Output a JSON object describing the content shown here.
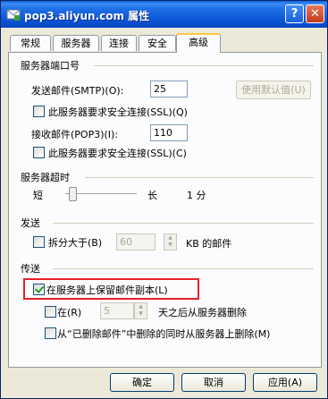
{
  "window": {
    "title": "pop3.aliyun.com 属性",
    "help_label": "?",
    "close_label": "✕"
  },
  "tabs": [
    {
      "label": "常规"
    },
    {
      "label": "服务器"
    },
    {
      "label": "连接"
    },
    {
      "label": "安全"
    },
    {
      "label": "高级"
    }
  ],
  "active_tab": "高级",
  "ports": {
    "group_title": "服务器端口号",
    "smtp_label": "发送邮件(SMTP)(O):",
    "smtp_value": "25",
    "use_default_label": "使用默认值(U)",
    "smtp_ssl_label": "此服务器要求安全连接(SSL)(Q)",
    "smtp_ssl_checked": false,
    "pop3_label": "接收邮件(POP3)(I):",
    "pop3_value": "110",
    "pop3_ssl_label": "此服务器要求安全连接(SSL)(C)",
    "pop3_ssl_checked": false
  },
  "timeout": {
    "group_title": "服务器超时",
    "short_label": "短",
    "long_label": "长",
    "value_label": "1 分",
    "slider_level": 0.1
  },
  "send": {
    "group_title": "发送",
    "split_label": "拆分大于(B)",
    "split_checked": false,
    "split_value": "60",
    "split_unit": "KB 的邮件"
  },
  "delivery": {
    "group_title": "传送",
    "keep_copy_label": "在服务器上保留邮件副本(L)",
    "keep_copy_checked": true,
    "remove_after_prefix": "在(R)",
    "remove_after_value": "5",
    "remove_after_suffix": "天之后从服务器删除",
    "remove_after_checked": false,
    "remove_when_deleted_label": "从“已删除邮件”中删除的同时从服务器上删除(M)",
    "remove_when_deleted_checked": false
  },
  "buttons": {
    "ok": "确定",
    "cancel": "取消",
    "apply": "应用(A)"
  },
  "colors": {
    "title_bar": "#0b56d6",
    "highlight_box": "#e8202a",
    "tab_active_accent": "#ffc83c"
  }
}
